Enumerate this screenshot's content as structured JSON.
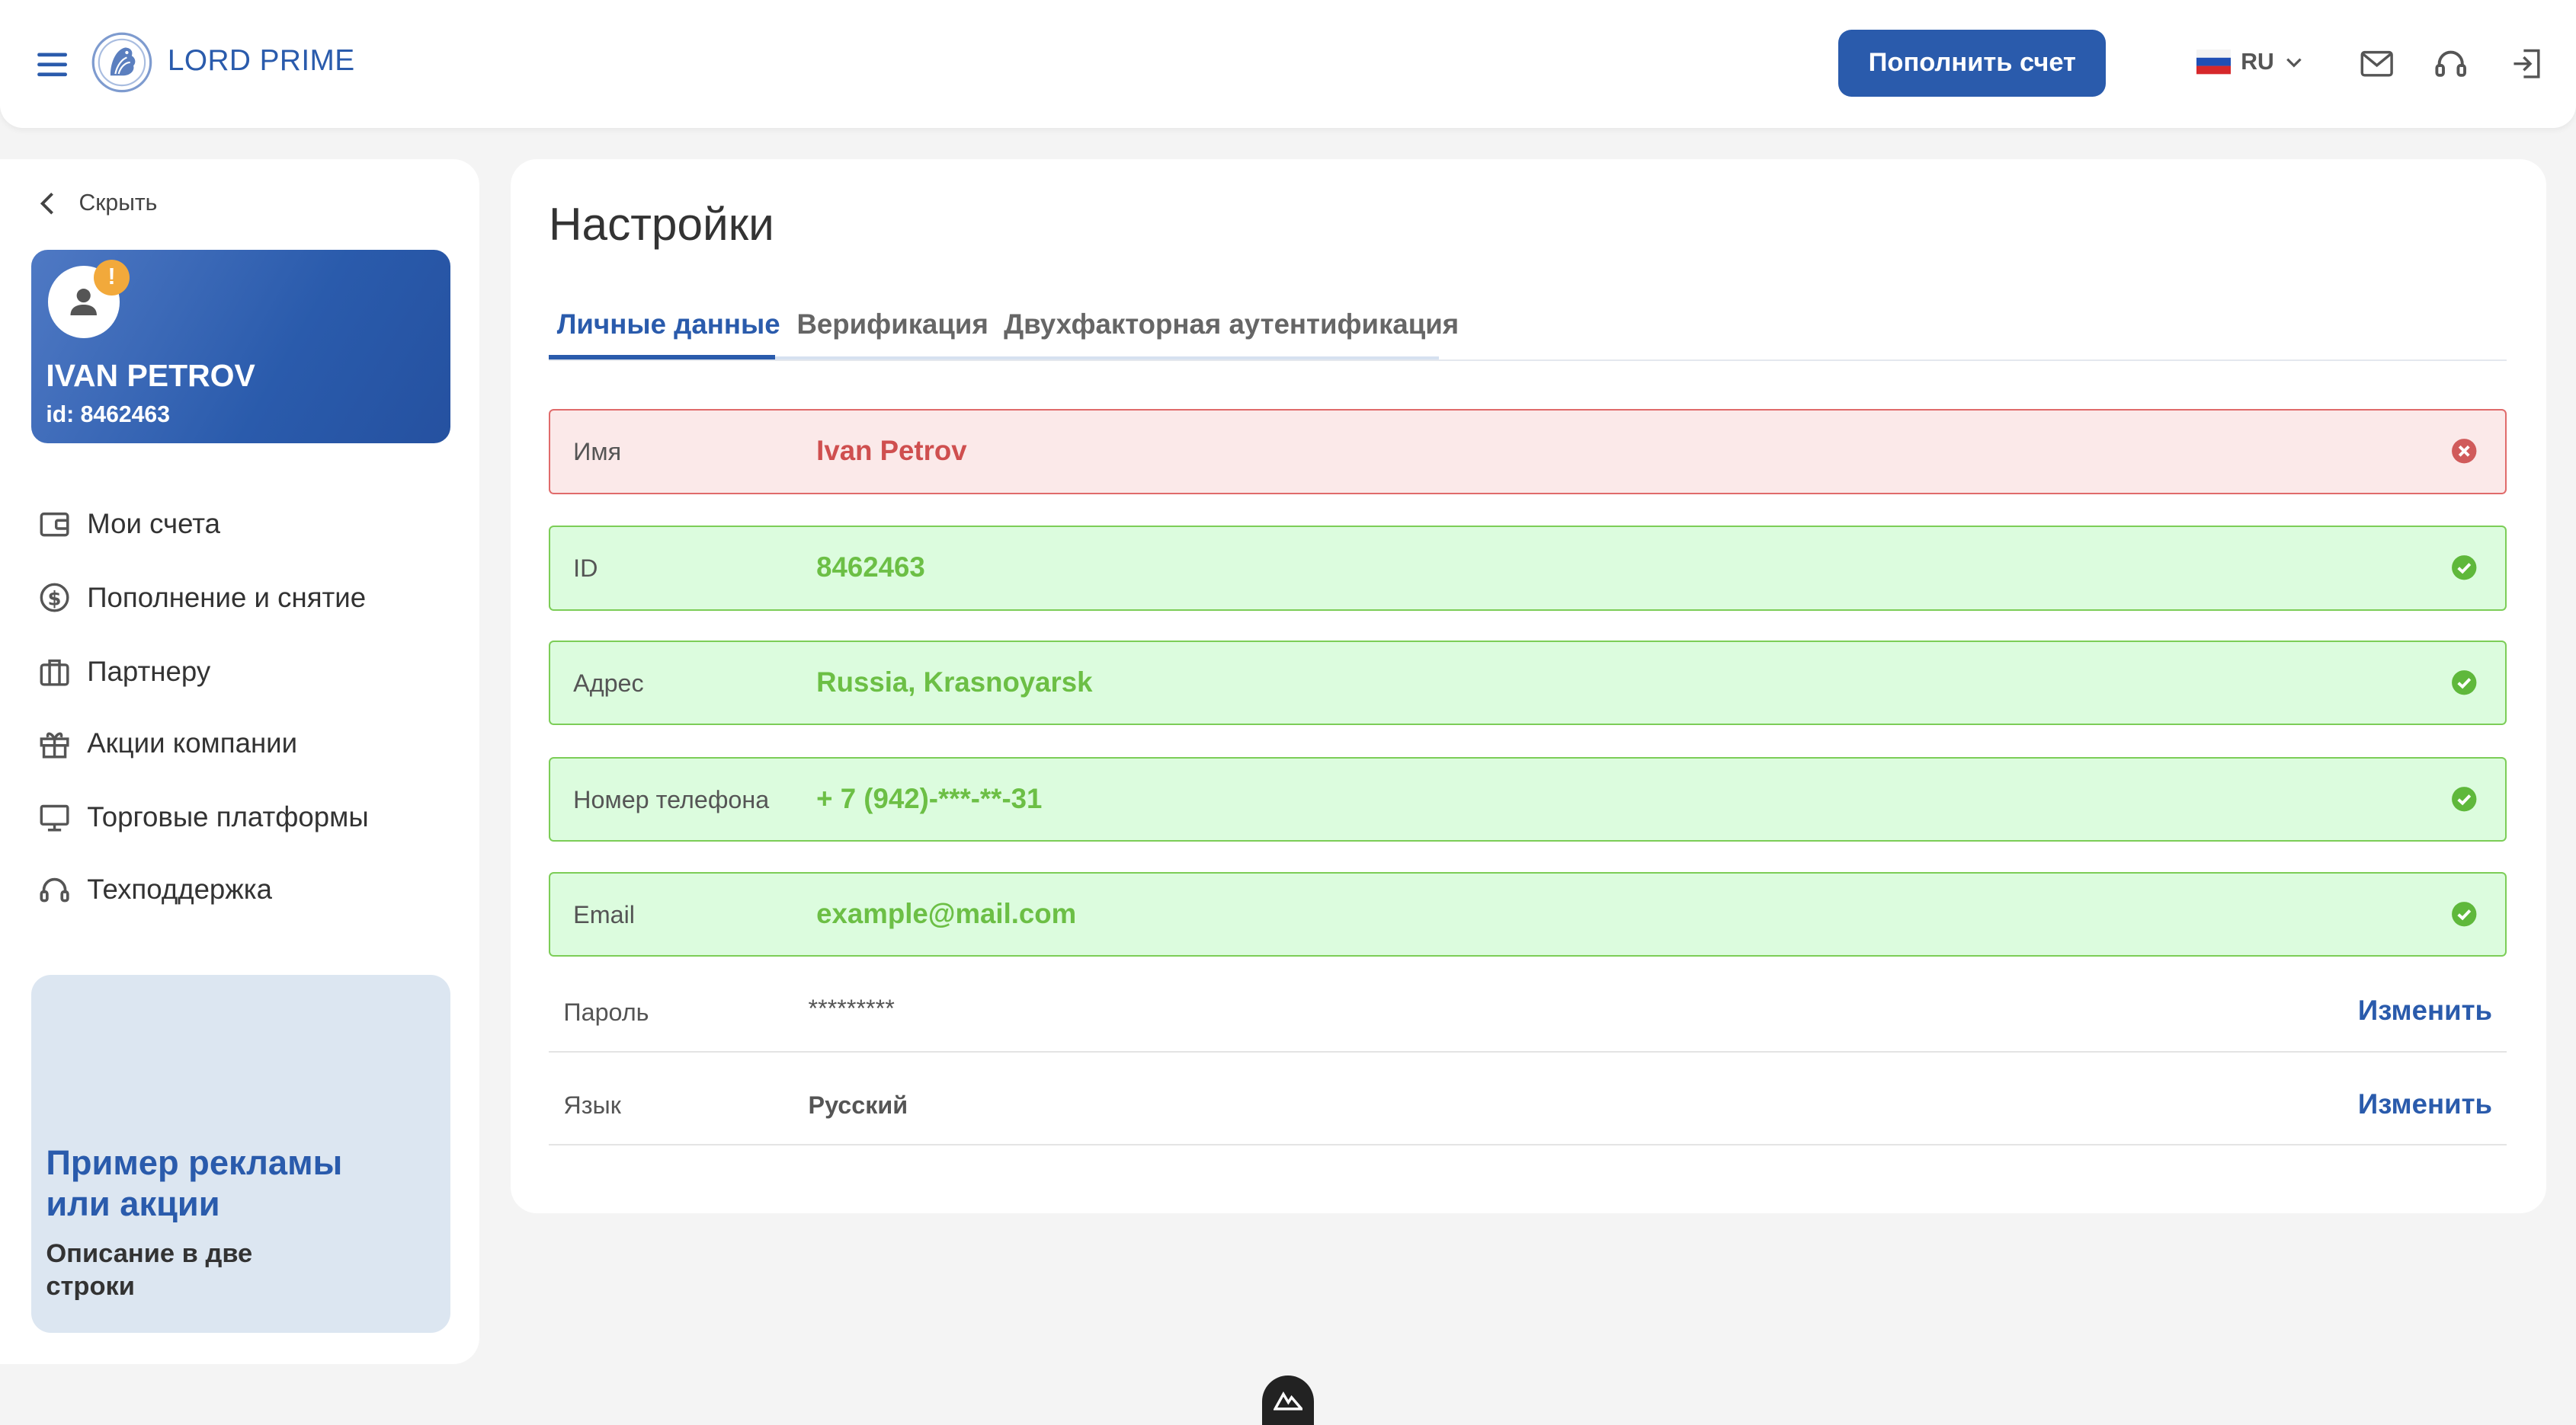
{
  "header": {
    "brand": "LORD PRIME",
    "topup_label": "Пополнить счет",
    "lang_code": "RU",
    "icons": [
      "menu-icon",
      "logo-icon",
      "mail-icon",
      "headset-icon",
      "logout-icon"
    ]
  },
  "sidebar": {
    "hide_label": "Скрыть",
    "profile": {
      "name": "IVAN PETROV",
      "id_label": "id: 8462463",
      "warning": "!"
    },
    "items": [
      {
        "label": "Мои счета",
        "icon": "wallet-icon"
      },
      {
        "label": "Пополнение и снятие",
        "icon": "dollar-icon"
      },
      {
        "label": "Партнеру",
        "icon": "briefcase-icon"
      },
      {
        "label": "Акции компании",
        "icon": "gift-icon"
      },
      {
        "label": "Торговые платформы",
        "icon": "monitor-icon"
      },
      {
        "label": "Техподдержка",
        "icon": "headset-icon"
      }
    ],
    "promo": {
      "title": "Пример рекламы или акции",
      "description": "Описание в две строки"
    }
  },
  "main": {
    "title": "Настройки",
    "tabs": [
      {
        "label": "Личные данные",
        "active": true
      },
      {
        "label": "Верификация",
        "active": false
      },
      {
        "label": "Двухфакторная аутентификация",
        "active": false
      }
    ],
    "fields": [
      {
        "label": "Имя",
        "value": "Ivan Petrov",
        "status": "error"
      },
      {
        "label": "ID",
        "value": "8462463",
        "status": "ok"
      },
      {
        "label": "Адрес",
        "value": "Russia, Krasnoyarsk",
        "status": "ok"
      },
      {
        "label": "Номер телефона",
        "value": "+ 7 (942)-***-**-31",
        "status": "ok"
      },
      {
        "label": "Email",
        "value": "example@mail.com",
        "status": "ok"
      }
    ],
    "password": {
      "label": "Пароль",
      "value": "*********",
      "action": "Изменить"
    },
    "language": {
      "label": "Язык",
      "value": "Русский",
      "action": "Изменить"
    }
  },
  "colors": {
    "accent": "#2a5bac",
    "error_bg": "#fbe9e9",
    "error_border": "#e06b6b",
    "ok_bg": "#dcfcde",
    "ok_border": "#7ccd57",
    "warning": "#f2a93b"
  }
}
